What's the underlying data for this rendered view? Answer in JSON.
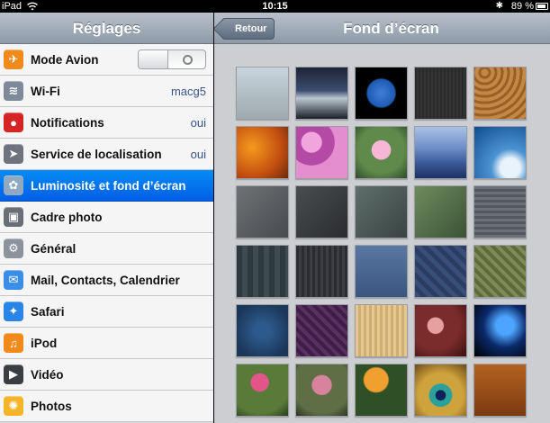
{
  "status_bar": {
    "carrier": "iPad",
    "wifi_icon": "wifi-icon",
    "time": "10:15",
    "bluetooth_icon": "bluetooth-icon",
    "battery_percent": "89 %",
    "battery_icon": "battery-icon"
  },
  "settings": {
    "title": "Réglages",
    "items": [
      {
        "label": "Mode Avion",
        "icon": "airplane-icon",
        "icon_color": "#f08a1c",
        "toggle": "off"
      },
      {
        "label": "Wi-Fi",
        "icon": "wifi-icon",
        "icon_color": "#7e8a99",
        "value": "macg5"
      },
      {
        "label": "Notifications",
        "icon": "notifications-icon",
        "icon_color": "#d62424",
        "value": "oui"
      },
      {
        "label": "Service de localisation",
        "icon": "location-icon",
        "icon_color": "#6d7480",
        "value": "oui"
      },
      {
        "label": "Luminosité et fond d’écran",
        "icon": "brightness-wallpaper-icon",
        "icon_color": "#8fa9c2",
        "selected": true
      },
      {
        "label": "Cadre photo",
        "icon": "picture-frame-icon",
        "icon_color": "#6a6f77"
      },
      {
        "label": "Général",
        "icon": "gear-icon",
        "icon_color": "#8c939c"
      },
      {
        "label": "Mail, Contacts, Calendrier",
        "icon": "mail-icon",
        "icon_color": "#3a8ee8"
      },
      {
        "label": "Safari",
        "icon": "safari-icon",
        "icon_color": "#2a86e6"
      },
      {
        "label": "iPod",
        "icon": "ipod-icon",
        "icon_color": "#f28a1b"
      },
      {
        "label": "Vidéo",
        "icon": "video-icon",
        "icon_color": "#3a3d42"
      },
      {
        "label": "Photos",
        "icon": "photos-icon",
        "icon_color": "#f4b52b"
      }
    ]
  },
  "wallpaper": {
    "title": "Fond d’écran",
    "back_label": "Retour",
    "tiles": [
      {
        "name": "birds-sky-wallpaper",
        "bg": "linear-gradient(#c7d4db,#9ea9b0)"
      },
      {
        "name": "lake-sunset-wallpaper",
        "bg": "linear-gradient(#1d2437 0%,#3c4d70 45%,#b9c6d2 60%,#1a1f28 100%)"
      },
      {
        "name": "earth-wallpaper",
        "bg": "radial-gradient(circle at 50% 50%,#3f7ed8 0%,#1e5ab2 38%,#000 42%)"
      },
      {
        "name": "dark-texture-wallpaper",
        "bg": "repeating-linear-gradient(90deg,#2a2a2a 0 2px,#333 2px 4px)"
      },
      {
        "name": "wood-rings-wallpaper",
        "bg": "repeating-radial-gradient(circle at 20% 10%,#c48846 0 4px,#9a5f26 4px 7px)"
      },
      {
        "name": "autumn-leaves-wallpaper",
        "bg": "radial-gradient(circle at 30% 40%,#f59a1d,#c44f10 60%,#6b2a0a)"
      },
      {
        "name": "pink-camo-wallpaper",
        "bg": "radial-gradient(circle at 30% 30%,#f2a5dd 0 20%,#b44aa6 21% 45%,#e48ed0 46%)"
      },
      {
        "name": "water-lily-wallpaper",
        "bg": "radial-gradient(circle at 50% 45%,#f7b6d6 0 25%,#5f8a4b 26% 60%,#2f4a2a)"
      },
      {
        "name": "blue-mountains-wallpaper",
        "bg": "linear-gradient(#a9c2e6 0%,#6f8fc9 40%,#3b5a9a 70%,#1d3163)"
      },
      {
        "name": "wave-wallpaper",
        "bg": "radial-gradient(circle at 70% 80%,#e8f3fb 0 18%,#4b93d2 35%,#0e4b8f)"
      },
      {
        "name": "gray-pebbles-wallpaper",
        "bg": "linear-gradient(135deg,#6e7275,#484b4e)"
      },
      {
        "name": "dark-feathers-wallpaper",
        "bg": "linear-gradient(135deg,#4a4d50,#2a2c2e)"
      },
      {
        "name": "teal-rain-wallpaper",
        "bg": "linear-gradient(135deg,#5f6e6c,#394441)"
      },
      {
        "name": "green-fabric-wallpaper",
        "bg": "linear-gradient(135deg,#6f8a5e,#3c5235)"
      },
      {
        "name": "cobblestone-wallpaper",
        "bg": "repeating-linear-gradient(0deg,#6b7178 0 3px,#53585e 3px 6px)"
      },
      {
        "name": "plaid-wallpaper",
        "bg": "repeating-linear-gradient(90deg,#2d3a3c 0 6px,#3d4b4e 6px 12px)"
      },
      {
        "name": "dark-stripes-wallpaper",
        "bg": "repeating-linear-gradient(90deg,#2b2c30 0 3px,#3c3e43 3px 6px)"
      },
      {
        "name": "denim-wallpaper",
        "bg": "linear-gradient(#5877a1,#3a5680)"
      },
      {
        "name": "blue-geometric-wallpaper",
        "bg": "repeating-linear-gradient(45deg,#3a4e7a 0 5px,#2c3d63 5px 10px)"
      },
      {
        "name": "olive-pattern-wallpaper",
        "bg": "repeating-linear-gradient(45deg,#7f8a56 0 4px,#5f6a3c 4px 8px)"
      },
      {
        "name": "navy-dots-wallpaper",
        "bg": "radial-gradient(circle,#2d5a8c 20%,#1a3658 80%)"
      },
      {
        "name": "plum-weave-wallpaper",
        "bg": "repeating-linear-gradient(45deg,#5a2f62 0 4px,#3e1e45 4px 8px)"
      },
      {
        "name": "beige-weave-wallpaper",
        "bg": "repeating-linear-gradient(90deg,#e5c88f 0 3px,#cfae72 3px 6px)"
      },
      {
        "name": "sakura-wallpaper",
        "bg": "radial-gradient(circle at 40% 40%,#e6a0a0 0 18%,#7a2b2b 20% 55%,#3b0f12)"
      },
      {
        "name": "blue-bokeh-wallpaper",
        "bg": "radial-gradient(circle at 60% 40%,#4ea5ff 0 20%,#0b2a6a 50%,#000)"
      },
      {
        "name": "pink-rose-wallpaper",
        "bg": "radial-gradient(circle at 45% 35%,#e25588 0 20%,#5a7a3a 22% 70%,#253e1b)"
      },
      {
        "name": "roses-wallpaper",
        "bg": "radial-gradient(circle at 50% 40%,#d7839d 0 24%,#5e6f46 26% 70%,#2b3320)"
      },
      {
        "name": "orange-poppy-wallpaper",
        "bg": "radial-gradient(circle at 40% 30%,#f1a030 0 25%,#2f4f27 28%)"
      },
      {
        "name": "peacock-feather-wallpaper",
        "bg": "radial-gradient(circle at 50% 60%,#0f1f5a 0 12%,#2aa19a 14% 28%,#cfa33c 30% 55%,#6b4a18)"
      },
      {
        "name": "tiki-mask-wallpaper",
        "bg": "linear-gradient(#b56221,#7a3a10)"
      }
    ]
  }
}
